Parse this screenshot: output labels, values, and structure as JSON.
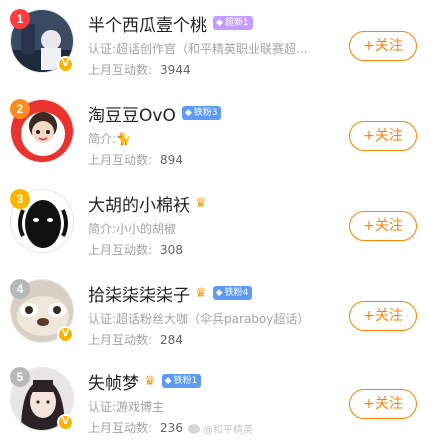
{
  "users": [
    {
      "rank": "1",
      "rank_color": "#ff3b3b",
      "name": "半个西瓜壹个桃",
      "badge": {
        "text": "超新1",
        "color": "#c59cff"
      },
      "crown": false,
      "desc": "认证:超话创作官（和平精英职业联赛超...",
      "stat_label": "上月互动数:",
      "stat_value": "3944",
      "follow_label": "+关注",
      "verified": true,
      "avatar": "avatar-1"
    },
    {
      "rank": "2",
      "rank_color": "#ff8a1f",
      "name": "淘豆豆OvO",
      "badge": {
        "text": "铁粉3",
        "color": "#5d9bf5"
      },
      "crown": false,
      "desc": "简介:🐈",
      "stat_label": "上月互动数:",
      "stat_value": "894",
      "follow_label": "+关注",
      "verified": false,
      "avatar": "avatar-2"
    },
    {
      "rank": "3",
      "rank_color": "#ffb400",
      "name": "大胡的小棉袄",
      "badge": null,
      "crown": true,
      "desc": "简介:小小的胡椒",
      "stat_label": "上月互动数:",
      "stat_value": "308",
      "follow_label": "+关注",
      "verified": false,
      "avatar": "avatar-3"
    },
    {
      "rank": "4",
      "rank_color": "#b8b8b8",
      "name": "拾柒柒柒柒子",
      "badge": {
        "text": "铁粉4",
        "color": "#5d9bf5"
      },
      "crown": true,
      "desc": "认证:超话粉丝大咖（伞兵paraboy超话）",
      "stat_label": "上月互动数:",
      "stat_value": "284",
      "follow_label": "+关注",
      "verified": true,
      "avatar": "avatar-4"
    },
    {
      "rank": "5",
      "rank_color": "#b8b8b8",
      "name": "失帧梦",
      "badge": {
        "text": "铁粉1",
        "color": "#5d9bf5"
      },
      "crown": true,
      "desc": "认证:游戏博主",
      "stat_label": "上月互动数:",
      "stat_value": "236",
      "follow_label": "+关注",
      "verified": true,
      "avatar": "avatar-5"
    }
  ],
  "watermark": "@和平精英"
}
